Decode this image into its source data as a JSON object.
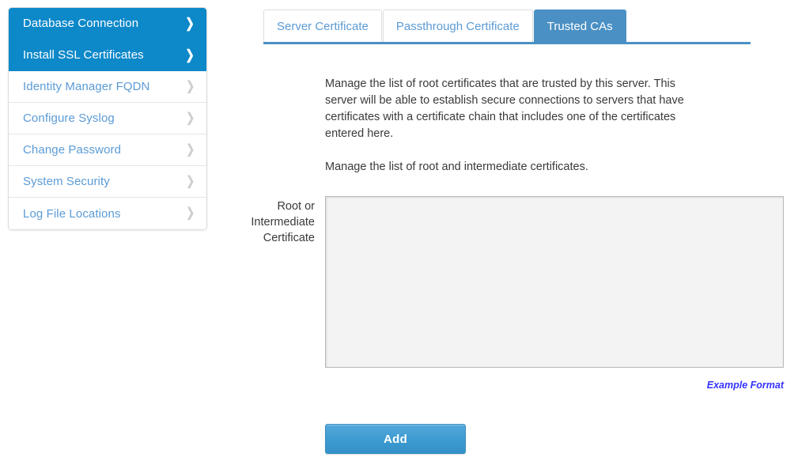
{
  "sidebar": {
    "items": [
      {
        "label": "Database Connection",
        "active": false,
        "chevron_icon": "chevron-right-icon"
      },
      {
        "label": "Install SSL Certificates",
        "active": true,
        "chevron_icon": "chevron-right-icon"
      },
      {
        "label": "Identity Manager FQDN",
        "active": false,
        "chevron_icon": "chevron-right-icon"
      },
      {
        "label": "Configure Syslog",
        "active": false,
        "chevron_icon": "chevron-right-icon"
      },
      {
        "label": "Change Password",
        "active": false,
        "chevron_icon": "chevron-right-icon"
      },
      {
        "label": "System Security",
        "active": false,
        "chevron_icon": "chevron-right-icon"
      },
      {
        "label": "Log File Locations",
        "active": false,
        "chevron_icon": "chevron-right-icon"
      }
    ]
  },
  "tabs": [
    {
      "label": "Server Certificate",
      "active": false
    },
    {
      "label": "Passthrough Certificate",
      "active": false
    },
    {
      "label": "Trusted CAs",
      "active": true
    }
  ],
  "main": {
    "paragraph_1": "Manage the list of root certificates that are trusted by this server. This server will be able to establish secure connections to servers that have certificates with a certificate chain that includes one of the certificates entered here.",
    "paragraph_2": "Manage the list of root and intermediate certificates.",
    "field_label": "Root or Intermediate Certificate",
    "certificate_value": "",
    "certificate_placeholder": "",
    "example_format_link": "Example Format",
    "add_button_label": "Add"
  },
  "colors": {
    "sidebar_active_blue": "#0d88c9",
    "tab_active_blue": "#4a90c4",
    "link_blue": "#5b9bd5",
    "example_link": "#3333ff",
    "button_blue": "#3f9bd0",
    "textarea_fill": "#f3f3f3"
  }
}
